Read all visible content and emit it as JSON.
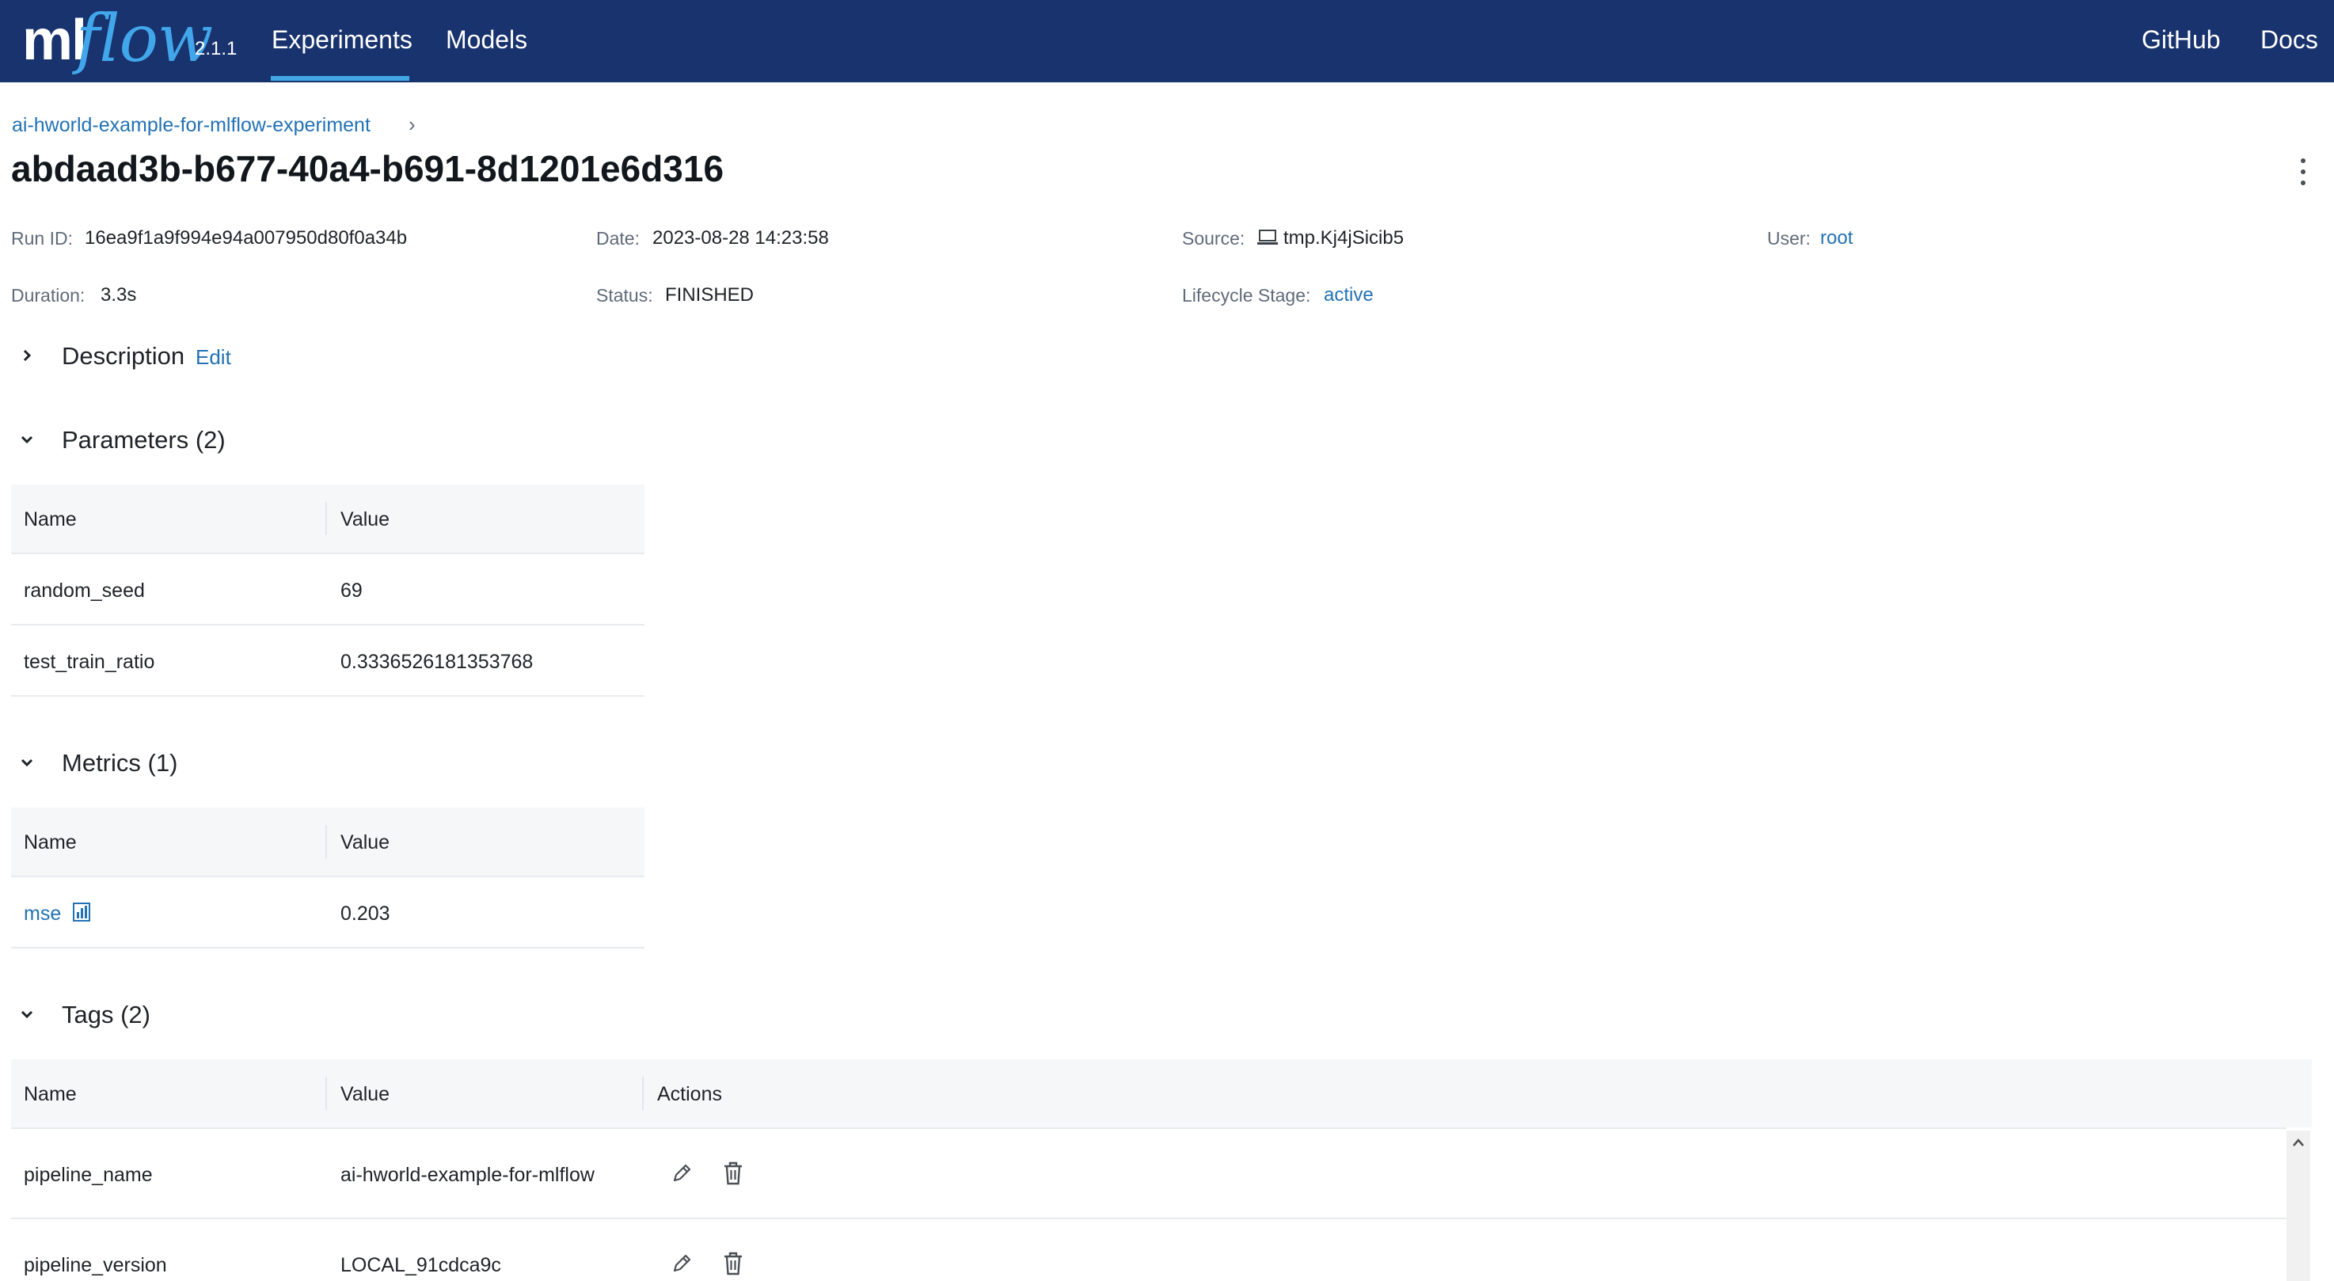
{
  "nav": {
    "logo_ml": "ml",
    "logo_flow": "flow",
    "version": "2.1.1",
    "experiments": "Experiments",
    "models": "Models",
    "github": "GitHub",
    "docs": "Docs"
  },
  "breadcrumb": {
    "experiment": "ai-hworld-example-for-mlflow-experiment",
    "separator": "›"
  },
  "title": "abdaad3b-b677-40a4-b691-8d1201e6d316",
  "meta": {
    "run_id_label": "Run ID:",
    "run_id": "16ea9f1a9f994e94a007950d80f0a34b",
    "date_label": "Date:",
    "date": "2023-08-28 14:23:58",
    "source_label": "Source:",
    "source": "tmp.Kj4jSicib5",
    "user_label": "User:",
    "user": "root",
    "duration_label": "Duration:",
    "duration": "3.3s",
    "status_label": "Status:",
    "status": "FINISHED",
    "lifecycle_label": "Lifecycle Stage:",
    "lifecycle": "active"
  },
  "description": {
    "title": "Description",
    "edit": "Edit"
  },
  "parameters": {
    "title": "Parameters (2)",
    "headers": [
      "Name",
      "Value"
    ],
    "rows": [
      {
        "name": "random_seed",
        "value": "69"
      },
      {
        "name": "test_train_ratio",
        "value": "0.3336526181353768"
      }
    ]
  },
  "metrics": {
    "title": "Metrics (1)",
    "headers": [
      "Name",
      "Value"
    ],
    "rows": [
      {
        "name": "mse",
        "value": "0.203"
      }
    ]
  },
  "tags": {
    "title": "Tags (2)",
    "headers": [
      "Name",
      "Value",
      "Actions"
    ],
    "rows": [
      {
        "name": "pipeline_name",
        "value": "ai-hworld-example-for-mlflow"
      },
      {
        "name": "pipeline_version",
        "value": "LOCAL_91cdca9c"
      }
    ]
  },
  "colors": {
    "nav_bg": "#18336d",
    "accent": "#43a7e6",
    "link": "#2272b4"
  },
  "icons": [
    "chevron-right-icon",
    "chevron-down-icon",
    "computer-icon",
    "chart-icon",
    "pencil-icon",
    "trash-icon",
    "kebab-menu-icon"
  ]
}
